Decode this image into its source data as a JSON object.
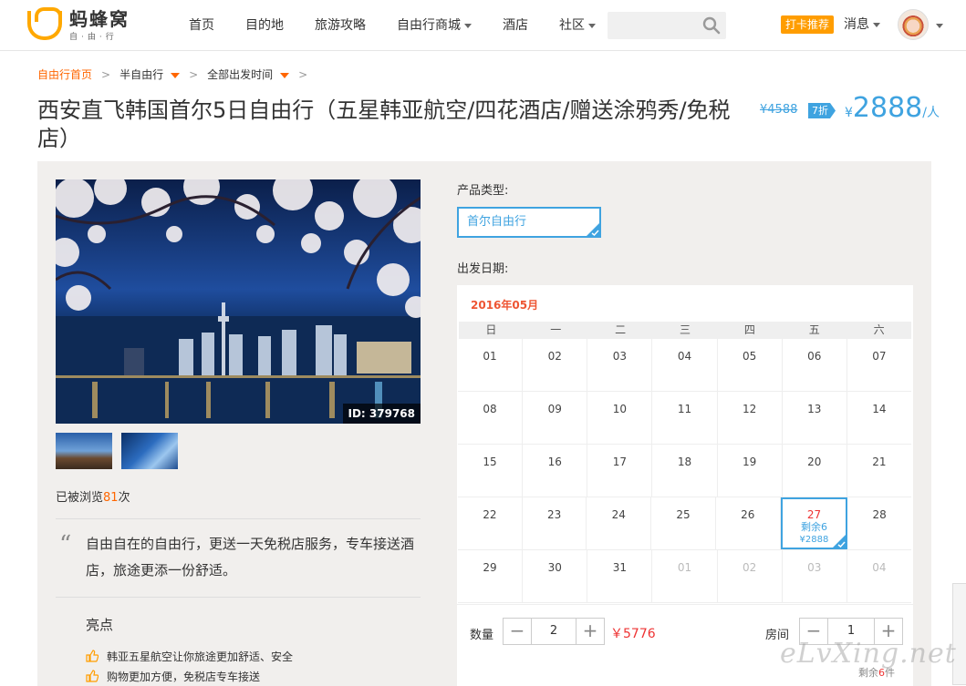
{
  "header": {
    "logo_main": "蚂蜂窝",
    "logo_sub": "自·由·行",
    "nav": [
      "首页",
      "目的地",
      "旅游攻略",
      "自由行商城",
      "酒店",
      "社区"
    ],
    "search_placeholder": "",
    "checkin_badge": "打卡推荐",
    "messages": "消息"
  },
  "breadcrumb": {
    "home": "自由行首页",
    "level2": "半自由行",
    "level3": "全部出发时间",
    "sep": ">"
  },
  "product": {
    "title": "西安直飞韩国首尔5日自由行（五星韩亚航空/四花酒店/赠送涂鸦秀/免税店）",
    "price_old": "¥4588",
    "discount": "7折",
    "currency": "¥",
    "price_now": "2888",
    "price_unit": "/人"
  },
  "gallery": {
    "photo_id": "ID: 379768"
  },
  "stats": {
    "views_prefix": "已被浏览",
    "views": "81",
    "views_suffix": "次"
  },
  "quote": {
    "mark": "“",
    "text": "自由自在的自由行，更送一天免税店服务，专车接送酒店，旅途更添一份舒适。"
  },
  "highlights": {
    "title": "亮点",
    "items": [
      "韩亚五星航空让你旅途更加舒适、安全",
      "购物更加方便，免税店专车接送"
    ]
  },
  "booking": {
    "type_label": "产品类型:",
    "type_value": "首尔自由行",
    "date_label": "出发日期:",
    "month": "2016年05月",
    "weekdays": [
      "日",
      "一",
      "二",
      "三",
      "四",
      "五",
      "六"
    ],
    "weeks": [
      [
        "01",
        "02",
        "03",
        "04",
        "05",
        "06",
        "07"
      ],
      [
        "08",
        "09",
        "10",
        "11",
        "12",
        "13",
        "14"
      ],
      [
        "15",
        "16",
        "17",
        "18",
        "19",
        "20",
        "21"
      ],
      [
        "22",
        "23",
        "24",
        "25",
        "26",
        "27",
        "28"
      ],
      [
        "29",
        "30",
        "31",
        "01",
        "02",
        "03",
        "04"
      ]
    ],
    "dim_cells": [
      [
        4,
        3
      ],
      [
        4,
        4
      ],
      [
        4,
        5
      ],
      [
        4,
        6
      ]
    ],
    "selected_cell": [
      3,
      5
    ],
    "selected_remaining": "剩余6",
    "selected_price": "¥2888",
    "qty_label": "数量",
    "qty_value": "2",
    "total": "￥5776",
    "room_label": "房间",
    "room_value": "1",
    "stock_prefix": "剩余",
    "stock_num": "6",
    "stock_suffix": "件",
    "minus": "−",
    "plus": "+"
  },
  "watermark": "eLvXing.net",
  "colors": {
    "accent_blue": "#3fa3e0",
    "accent_orange": "#ff6600",
    "price_red": "#ee3333"
  }
}
